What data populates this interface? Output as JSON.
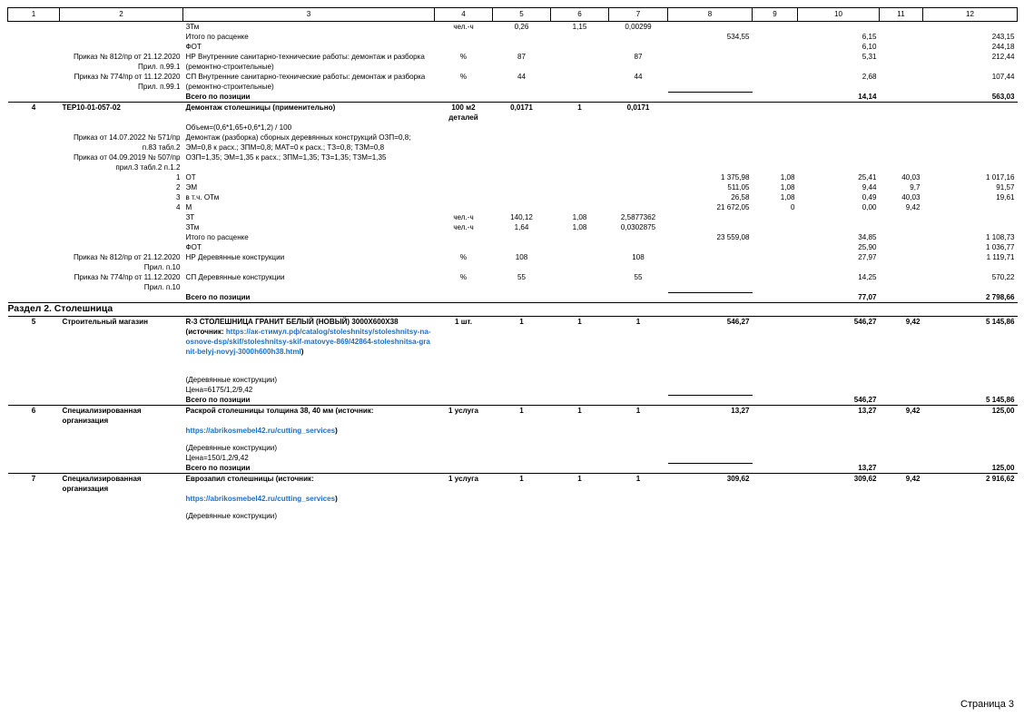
{
  "headers": [
    "1",
    "2",
    "3",
    "4",
    "5",
    "6",
    "7",
    "8",
    "9",
    "10",
    "11",
    "12"
  ],
  "rows": [
    {
      "k": "row",
      "c": [
        "",
        "",
        "ЗТм",
        "чел.-ч",
        "0,26",
        "1,15",
        "0,00299",
        "",
        "",
        "",
        "",
        ""
      ]
    },
    {
      "k": "row",
      "c": [
        "",
        "",
        "Итого по расценке",
        "",
        "",
        "",
        "",
        "534,55",
        "",
        "6,15",
        "",
        "243,15"
      ]
    },
    {
      "k": "row",
      "c": [
        "",
        "",
        "ФОТ",
        "",
        "",
        "",
        "",
        "",
        "",
        "6,10",
        "",
        "244,18"
      ]
    },
    {
      "k": "row",
      "c": [
        "",
        "Приказ № 812/пр от 21.12.2020 Прил. п.99.1",
        "НР Внутренние санитарно-технические работы: демонтаж и разборка (ремонтно-строительные)",
        "%",
        "87",
        "",
        "87",
        "",
        "",
        "5,31",
        "",
        "212,44"
      ]
    },
    {
      "k": "row",
      "c": [
        "",
        "Приказ № 774/пр от 11.12.2020 Прил. п.99.1",
        "СП Внутренние санитарно-технические работы: демонтаж и разборка (ремонтно-строительные)",
        "%",
        "44",
        "",
        "44",
        "",
        "",
        "2,68",
        "",
        "107,44"
      ]
    },
    {
      "k": "total",
      "c": [
        "",
        "",
        "Всего по позиции",
        "",
        "",
        "",
        "",
        "",
        "",
        "14,14",
        "",
        "563,03"
      ]
    },
    {
      "k": "item",
      "c": [
        "4",
        "ТЕР10-01-057-02",
        "Демонтаж столешницы (применительно)",
        "100 м2 деталей",
        "0,0171",
        "1",
        "0,0171",
        "",
        "",
        "",
        "",
        ""
      ]
    },
    {
      "k": "row",
      "c": [
        "",
        "",
        "Объем=(0,6*1,65+0,6*1,2) / 100",
        "",
        "",
        "",
        "",
        "",
        "",
        "",
        "",
        ""
      ]
    },
    {
      "k": "row",
      "c": [
        "",
        "Приказ от 14.07.2022 № 571/пр п.83 табл.2",
        "Демонтаж (разборка) сборных деревянных конструкций ОЗП=0,8; ЭМ=0,8 к расх.; ЗПМ=0,8; МАТ=0 к расх.; ТЗ=0,8; ТЗМ=0,8",
        "",
        "",
        "",
        "",
        "",
        "",
        "",
        "",
        ""
      ]
    },
    {
      "k": "row",
      "c": [
        "",
        "Приказ от 04.09.2019 № 507/пр прил.3 табл.2 п.1.2",
        "ОЗП=1,35; ЭМ=1,35 к расх.; ЗПМ=1,35; ТЗ=1,35; ТЗМ=1,35",
        "",
        "",
        "",
        "",
        "",
        "",
        "",
        "",
        ""
      ]
    },
    {
      "k": "row",
      "c": [
        "",
        "1",
        "ОТ",
        "",
        "",
        "",
        "",
        "1 375,98",
        "1,08",
        "25,41",
        "40,03",
        "1 017,16"
      ]
    },
    {
      "k": "row",
      "c": [
        "",
        "2",
        "ЭМ",
        "",
        "",
        "",
        "",
        "511,05",
        "1,08",
        "9,44",
        "9,7",
        "91,57"
      ]
    },
    {
      "k": "row",
      "c": [
        "",
        "3",
        "в т.ч. ОТм",
        "",
        "",
        "",
        "",
        "26,58",
        "1,08",
        "0,49",
        "40,03",
        "19,61"
      ]
    },
    {
      "k": "row",
      "c": [
        "",
        "4",
        "М",
        "",
        "",
        "",
        "",
        "21 672,05",
        "0",
        "0,00",
        "9,42",
        ""
      ]
    },
    {
      "k": "row",
      "c": [
        "",
        "",
        "ЗТ",
        "чел.-ч",
        "140,12",
        "1,08",
        "2,5877362",
        "",
        "",
        "",
        "",
        ""
      ]
    },
    {
      "k": "row",
      "c": [
        "",
        "",
        "ЗТм",
        "чел.-ч",
        "1,64",
        "1,08",
        "0,0302875",
        "",
        "",
        "",
        "",
        ""
      ]
    },
    {
      "k": "row",
      "c": [
        "",
        "",
        "Итого по расценке",
        "",
        "",
        "",
        "",
        "23 559,08",
        "",
        "34,85",
        "",
        "1 108,73"
      ]
    },
    {
      "k": "row",
      "c": [
        "",
        "",
        "ФОТ",
        "",
        "",
        "",
        "",
        "",
        "",
        "25,90",
        "",
        "1 036,77"
      ]
    },
    {
      "k": "row",
      "c": [
        "",
        "Приказ № 812/пр от 21.12.2020 Прил. п.10",
        "НР Деревянные конструкции",
        "%",
        "108",
        "",
        "108",
        "",
        "",
        "27,97",
        "",
        "1 119,71"
      ]
    },
    {
      "k": "row",
      "c": [
        "",
        "Приказ № 774/пр от 11.12.2020 Прил. п.10",
        "СП Деревянные конструкции",
        "%",
        "55",
        "",
        "55",
        "",
        "",
        "14,25",
        "",
        "570,22"
      ]
    },
    {
      "k": "total",
      "c": [
        "",
        "",
        "Всего по позиции",
        "",
        "",
        "",
        "",
        "",
        "",
        "77,07",
        "",
        "2 798,66"
      ]
    },
    {
      "k": "section",
      "c": [
        "Раздел 2. Столешница"
      ]
    },
    {
      "k": "item",
      "c": [
        "5",
        "Строительный магазин",
        "R-3 СТОЛЕШНИЦА ГРАНИТ БЕЛЫЙ (НОВЫЙ) 3000Х600Х38",
        "1 шт.",
        "1",
        "1",
        "1",
        "546,27",
        "",
        "546,27",
        "9,42",
        "5 145,86"
      ]
    },
    {
      "k": "row",
      "c": [
        "",
        "",
        "(Деревянные конструкции)",
        "",
        "",
        "",
        "",
        "",
        "",
        "",
        "",
        ""
      ]
    },
    {
      "k": "row",
      "c": [
        "",
        "",
        "Цена=6175/1,2/9,42",
        "",
        "",
        "",
        "",
        "",
        "",
        "",
        "",
        ""
      ]
    },
    {
      "k": "total",
      "c": [
        "",
        "",
        "Всего по позиции",
        "",
        "",
        "",
        "",
        "",
        "",
        "546,27",
        "",
        "5 145,86"
      ]
    },
    {
      "k": "item",
      "c": [
        "6",
        "Специализированная организация",
        "Раскрой столешницы толщина 38, 40 мм (источник:",
        "1 услуга",
        "1",
        "1",
        "1",
        "13,27",
        "",
        "13,27",
        "9,42",
        "125,00"
      ]
    },
    {
      "k": "row",
      "c": [
        "",
        "",
        "(Деревянные конструкции)",
        "",
        "",
        "",
        "",
        "",
        "",
        "",
        "",
        ""
      ]
    },
    {
      "k": "row",
      "c": [
        "",
        "",
        "Цена=150/1,2/9,42",
        "",
        "",
        "",
        "",
        "",
        "",
        "",
        "",
        ""
      ]
    },
    {
      "k": "total",
      "c": [
        "",
        "",
        "Всего по позиции",
        "",
        "",
        "",
        "",
        "",
        "",
        "13,27",
        "",
        "125,00"
      ]
    },
    {
      "k": "item",
      "c": [
        "7",
        "Специализированная организация",
        "Еврозапил столешницы (источник:",
        "1 услуга",
        "1",
        "1",
        "1",
        "309,62",
        "",
        "309,62",
        "9,42",
        "2 916,62"
      ]
    },
    {
      "k": "row",
      "c": [
        "",
        "",
        "(Деревянные конструкции)",
        "",
        "",
        "",
        "",
        "",
        "",
        "",
        "",
        ""
      ]
    }
  ],
  "links": {
    "item5_prefix": "(источник: ",
    "item5_url": "https://ак-стимул.рф/catalog/stoleshnitsy/stoleshnitsy-na-osnove-dsp/skif/stoleshnitsy-skif-matovye-869/42864-stoleshnitsa-granit-belyj-novyj-3000h600h38.html",
    "item5_suffix": ")",
    "item6_url": "https://abrikosmebel42.ru/cutting_services",
    "item7_url": "https://abrikosmebel42.ru/cutting_services",
    "link_suffix": ")"
  },
  "colors": {
    "link": "#1f6fc5",
    "border": "#000000"
  },
  "page": "Страница 3"
}
